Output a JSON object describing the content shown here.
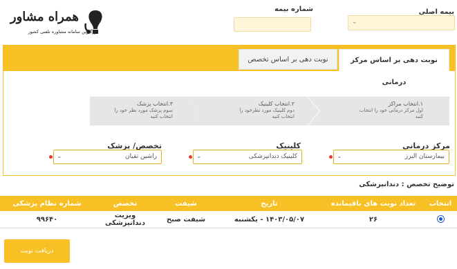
{
  "logo": {
    "brand": "همراه مشاور",
    "tagline": "بزرگترین سامانه مشاوره تلفنی کشور"
  },
  "filters": {
    "main_insurance_label": "بیمه اصلی",
    "insurance_number_label": "شماره بیمه"
  },
  "tabs": [
    {
      "label": "نوبت دهی بر اساس مرکز درمانی"
    },
    {
      "label": "نوبت دهی بر اساس تخصص"
    }
  ],
  "steps": [
    {
      "title": "۱.انتخاب مراکز",
      "desc": "اول مرکز درمانی خود را انتخاب کنید"
    },
    {
      "title": "۲.انتخاب کلینیک",
      "desc": "دوم کلینیک مورد نظرخود را انتخاب کنید"
    },
    {
      "title": "۳.انتخاب پزشک",
      "desc": "سوم پزشک مورد نظر خود را انتخاب کنید"
    }
  ],
  "selects": {
    "center_label": "مرکز درمانی",
    "center_value": "بیمارستان البرز",
    "clinic_label": "کلینیک",
    "clinic_value": "کلینیک دندانپزشکی",
    "doctor_label": "تخصص/ پزشک",
    "doctor_value": "راشین تقیان"
  },
  "specialty_note": "توضیح تخصص : دندانپزشکی",
  "table": {
    "headers": [
      "انتخاب",
      "تعداد نوبت های باقیمانده",
      "تاریخ",
      "شیفت",
      "تخصص",
      "شماره نظام پزشکی"
    ],
    "rows": [
      {
        "remaining": "۲۶",
        "date": "۱۴۰۳/۰۵/۰۷ - یکشنبه",
        "shift": "شیفت صبح",
        "specialty": "ویزیت دندانپزشکی",
        "code": "۹۹۶۴۰"
      }
    ]
  },
  "submit_label": "دریافت نوبت",
  "colors": {
    "accent": "#f7c126",
    "field": "#fff6d9",
    "step": "#e6e6e6"
  }
}
